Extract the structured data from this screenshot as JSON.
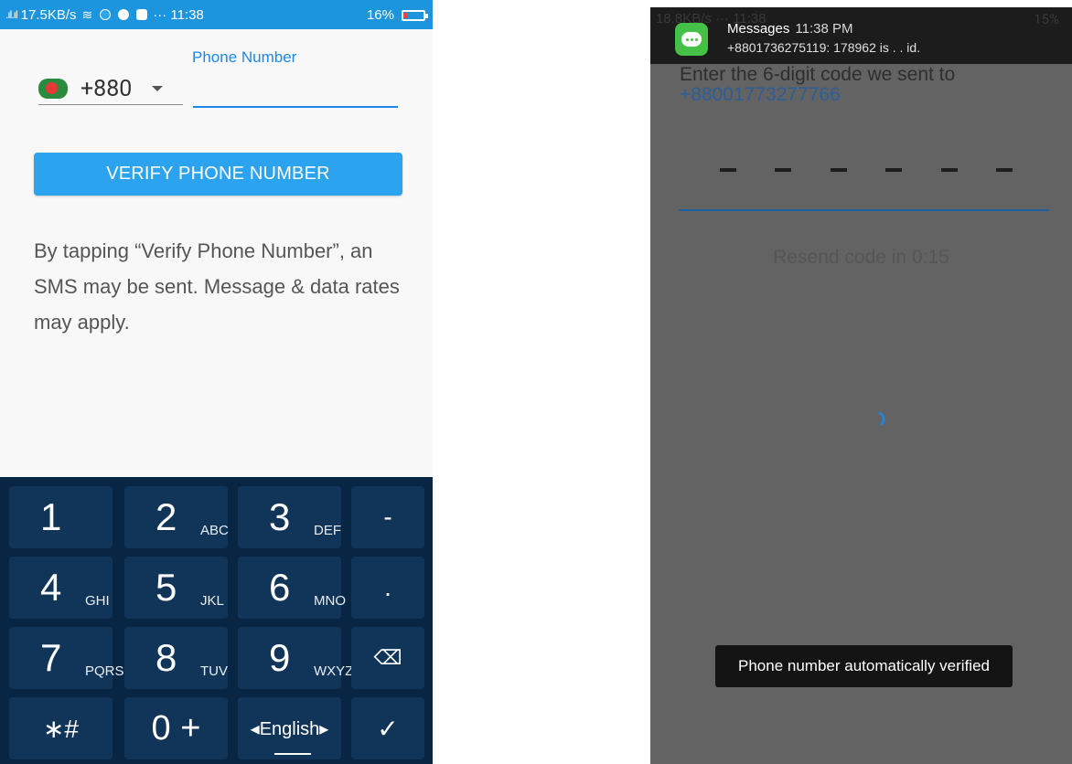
{
  "left": {
    "status": {
      "signal": ".ıl.ıl",
      "speed": "17.5KB/s",
      "time": "··· 11:38",
      "battery_pct": "16%",
      "battery_level": 0.16,
      "battery_color": "#ff3b3b"
    },
    "phone_label": "Phone Number",
    "country_code": "+880",
    "phone_value": "",
    "verify_button": "VERIFY PHONE NUMBER",
    "disclaimer": "By tapping “Verify Phone Number”, an SMS may be sent. Message & data rates may apply.",
    "keypad": {
      "rows": [
        [
          {
            "main": "1",
            "sub": ""
          },
          {
            "main": "2",
            "sub": "ABC"
          },
          {
            "main": "3",
            "sub": "DEF"
          },
          {
            "main": "-",
            "sub": ""
          }
        ],
        [
          {
            "main": "4",
            "sub": "GHI"
          },
          {
            "main": "5",
            "sub": "JKL"
          },
          {
            "main": "6",
            "sub": "MNO"
          },
          {
            "main": ".",
            "sub": ""
          }
        ],
        [
          {
            "main": "7",
            "sub": "PQRS"
          },
          {
            "main": "8",
            "sub": "TUV"
          },
          {
            "main": "9",
            "sub": "WXYZ"
          },
          {
            "main": "⌫",
            "sub": ""
          }
        ],
        [
          {
            "main": "∗#",
            "sub": ""
          },
          {
            "main": "0 +",
            "sub": ""
          },
          {
            "main": "◂English▸",
            "sub": ""
          },
          {
            "main": "✓",
            "sub": ""
          }
        ]
      ]
    },
    "accent_color": "#2ba3ee"
  },
  "right": {
    "status_under": "18.8KB/s ··· 11:38",
    "battery_pct": "15%",
    "notification": {
      "app": "Messages",
      "time": "11:38 PM",
      "body": "+8801736275119: 178962 is . . id."
    },
    "enter_code": "Enter the 6-digit code we sent to",
    "sent_number": "+88001773277766",
    "resend": "Resend code in 0:15",
    "toast": "Phone number automatically verified"
  }
}
